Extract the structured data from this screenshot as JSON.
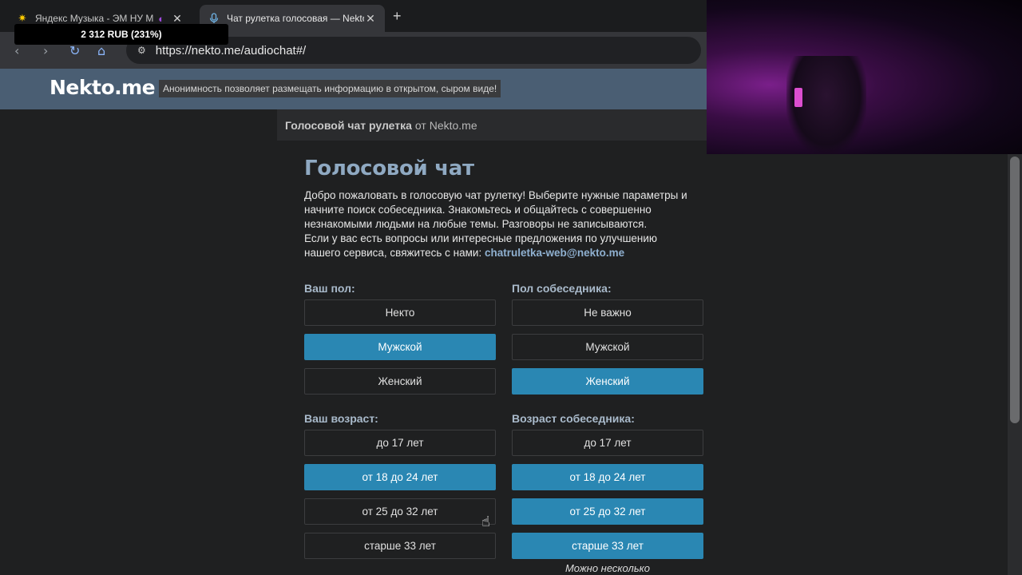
{
  "browser": {
    "tabs": [
      {
        "title": "Яндекс Музыка - ЭМ НУ Мира",
        "icon": "yandex-music-icon",
        "active": false
      },
      {
        "title": "Чат рулетка голосовая — Nekto.me",
        "icon": "microphone-icon",
        "active": true
      }
    ],
    "new_tab": "+",
    "url": "https://nekto.me/audiochat#/"
  },
  "overlay": {
    "donation": "2 312 RUB (231%)"
  },
  "site": {
    "logo": "Nekto.me",
    "slogan": "Анонимность позволяет размещать информацию в открытом, сыром виде!",
    "subtitle_bold": "Голосовой чат рулетка",
    "subtitle_rest": "от Nekto.me"
  },
  "main": {
    "title": "Голосовой чат",
    "intro_p1": "Добро пожаловать в голосовую чат рулетку! Выберите нужные параметры и начните поиск собеседника. Знакомьтесь и общайтесь с совершенно незнакомыми людьми на любые темы. Разговоры не записываются.",
    "intro_p2": "Если у вас есть вопросы или интересные предложения по улучшению нашего сервиса, свяжитесь с нами:",
    "email": "chatruletka-web@nekto.me"
  },
  "my_sex": {
    "label": "Ваш пол:",
    "options": [
      {
        "label": "Некто",
        "selected": false
      },
      {
        "label": "Мужской",
        "selected": true
      },
      {
        "label": "Женский",
        "selected": false
      }
    ]
  },
  "peer_sex": {
    "label": "Пол собеседника:",
    "options": [
      {
        "label": "Не важно",
        "selected": false
      },
      {
        "label": "Мужской",
        "selected": false
      },
      {
        "label": "Женский",
        "selected": true
      }
    ]
  },
  "my_age": {
    "label": "Ваш возраст:",
    "options": [
      {
        "label": "до 17 лет",
        "selected": false
      },
      {
        "label": "от 18 до 24 лет",
        "selected": true
      },
      {
        "label": "от 25 до 32 лет",
        "selected": false
      },
      {
        "label": "старше 33 лет",
        "selected": false
      }
    ]
  },
  "peer_age": {
    "label": "Возраст собеседника:",
    "options": [
      {
        "label": "до 17 лет",
        "selected": false
      },
      {
        "label": "от 18 до 24 лет",
        "selected": true
      },
      {
        "label": "от 25 до 32 лет",
        "selected": true
      },
      {
        "label": "старше 33 лет",
        "selected": true
      }
    ],
    "note": "Можно несколько"
  },
  "colors": {
    "accent": "#2a87b3",
    "header": "#4a5e73",
    "title": "#8fa9c2"
  }
}
